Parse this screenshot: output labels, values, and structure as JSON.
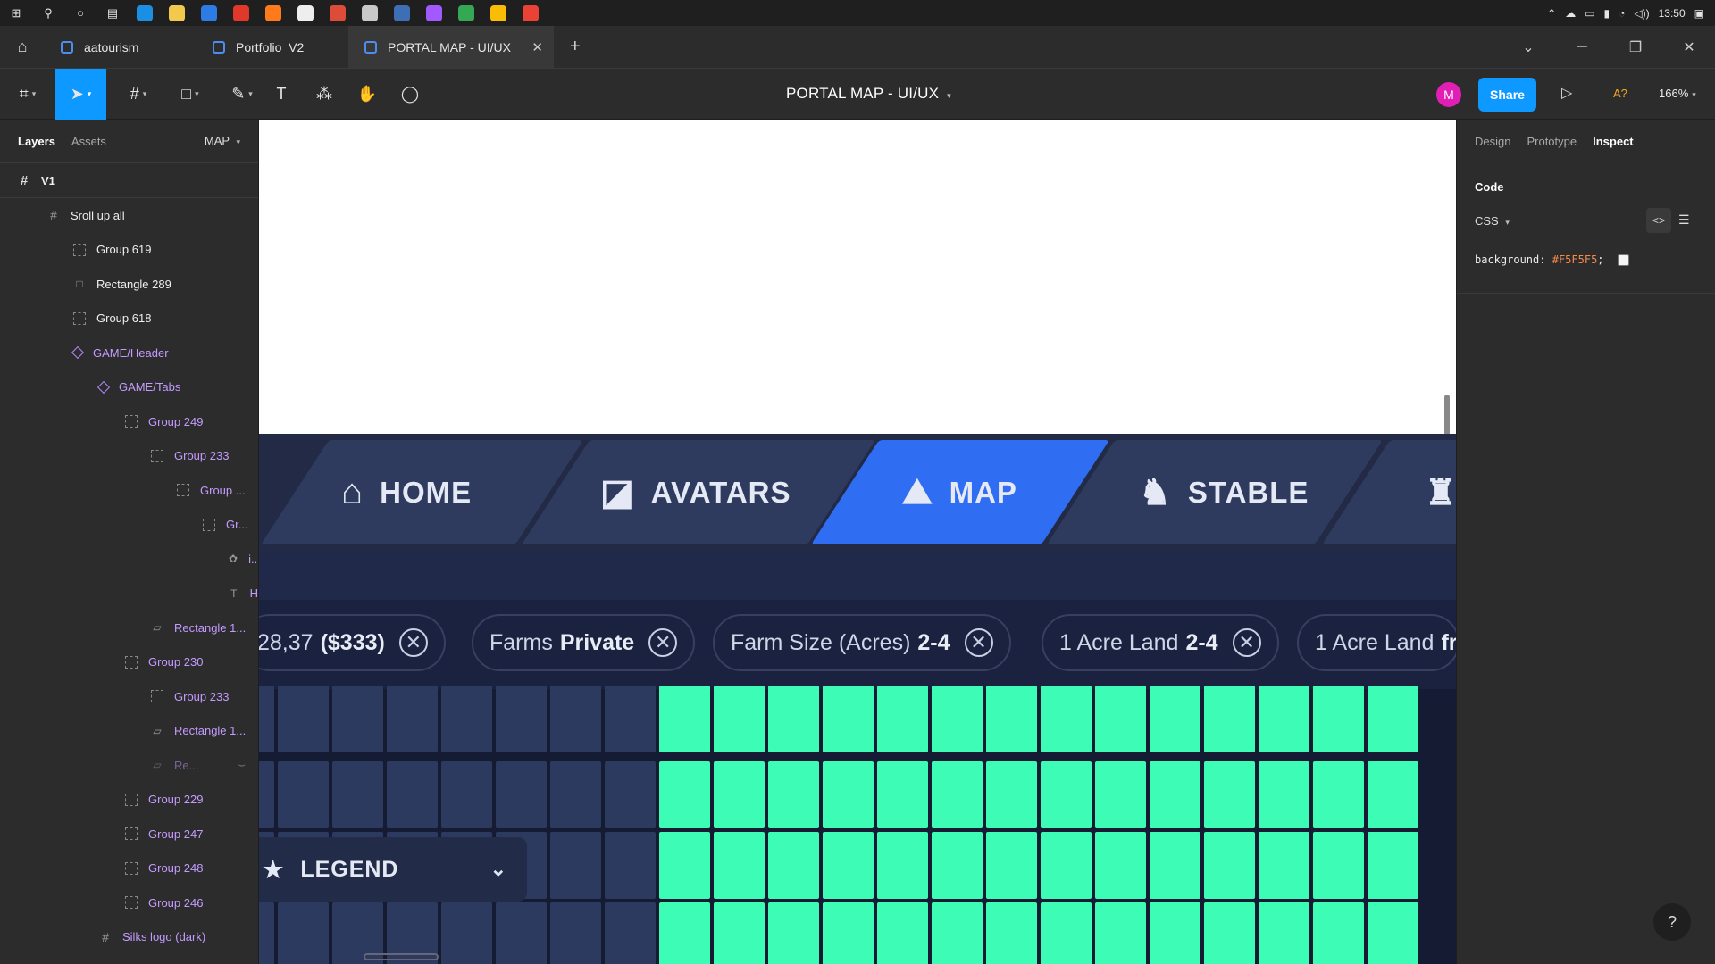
{
  "tray": {
    "time": "13:50"
  },
  "tabs": [
    {
      "label": "aatourism"
    },
    {
      "label": "Portfolio_V2"
    },
    {
      "label": "PORTAL MAP - UI/UX"
    }
  ],
  "toolbar": {
    "doc_title": "PORTAL MAP - UI/UX",
    "avatar_initial": "M",
    "share_label": "Share",
    "aq_label": "A?",
    "zoom": "166%"
  },
  "left_panel": {
    "tab_layers": "Layers",
    "tab_assets": "Assets",
    "page": "MAP",
    "frame": "V1",
    "layers": [
      {
        "label": "Sroll up all",
        "indent": 1,
        "icon": "frame-icon",
        "kind": "frame"
      },
      {
        "label": "Group 619",
        "indent": 2,
        "icon": "group-icon",
        "kind": "group"
      },
      {
        "label": "Rectangle 289",
        "indent": 2,
        "icon": "rectangle-icon",
        "kind": "rect"
      },
      {
        "label": "Group 618",
        "indent": 2,
        "icon": "group-icon",
        "kind": "group"
      },
      {
        "label": "GAME/Header",
        "indent": 2,
        "icon": "component-icon",
        "kind": "comp"
      },
      {
        "label": "GAME/Tabs",
        "indent": 3,
        "icon": "component-icon",
        "kind": "comp"
      },
      {
        "label": "Group 249",
        "indent": 4,
        "icon": "group-icon",
        "kind": "cgroup"
      },
      {
        "label": "Group 233",
        "indent": 5,
        "icon": "group-icon",
        "kind": "cgroup"
      },
      {
        "label": "Group ...",
        "indent": 6,
        "icon": "group-icon",
        "kind": "cgroup"
      },
      {
        "label": "Gr...",
        "indent": 7,
        "icon": "group-icon",
        "kind": "cgroup"
      },
      {
        "label": "i...",
        "indent": 8,
        "icon": "vector-icon",
        "kind": "cgroup"
      },
      {
        "label": "H",
        "indent": 8,
        "icon": "text-icon",
        "kind": "cgroup"
      },
      {
        "label": "Rectangle 1...",
        "indent": 5,
        "icon": "rectangle-icon",
        "kind": "cgroup"
      },
      {
        "label": "Group 230",
        "indent": 4,
        "icon": "group-icon",
        "kind": "cgroup"
      },
      {
        "label": "Group 233",
        "indent": 5,
        "icon": "group-icon",
        "kind": "cgroup"
      },
      {
        "label": "Rectangle 1...",
        "indent": 5,
        "icon": "rectangle-icon",
        "kind": "cgroup"
      },
      {
        "label": "Re...",
        "indent": 5,
        "icon": "rectangle-icon",
        "kind": "hidden"
      },
      {
        "label": "Group 229",
        "indent": 4,
        "icon": "group-icon",
        "kind": "cgroup"
      },
      {
        "label": "Group 247",
        "indent": 4,
        "icon": "group-icon",
        "kind": "cgroup"
      },
      {
        "label": "Group 248",
        "indent": 4,
        "icon": "group-icon",
        "kind": "cgroup"
      },
      {
        "label": "Group 246",
        "indent": 4,
        "icon": "group-icon",
        "kind": "cgroup"
      },
      {
        "label": "Silks logo (dark)",
        "indent": 3,
        "icon": "frame-icon",
        "kind": "comp"
      }
    ]
  },
  "game": {
    "tabs": [
      {
        "label": "HOME",
        "icon": "home-icon"
      },
      {
        "label": "AVATARS",
        "icon": "avatar-icon"
      },
      {
        "label": "MAP",
        "icon": "map-icon",
        "active": true
      },
      {
        "label": "STABLE",
        "icon": "horse-icon"
      }
    ],
    "chips": [
      {
        "text": "28,37",
        "bold": "($333)"
      },
      {
        "text": "Farms",
        "bold": "Private"
      },
      {
        "text": "Farm Size (Acres)",
        "bold": "2-4"
      },
      {
        "text": "1 Acre Land",
        "bold": "2-4"
      },
      {
        "text": "1 Acre Land",
        "bold": "fr"
      }
    ],
    "legend_label": "LEGEND"
  },
  "right_panel": {
    "tab_design": "Design",
    "tab_prototype": "Prototype",
    "tab_inspect": "Inspect",
    "code_heading": "Code",
    "language": "CSS",
    "css_prop": "background:",
    "css_value": "#F5F5F5",
    "css_end": ";",
    "help": "?"
  },
  "colors": {
    "accent": "#0d99ff",
    "game_active_tab": "#2f6df2",
    "map_green": "#3dfcb6",
    "map_dark": "#2d3a5f",
    "swatch": "#F5F5F5"
  }
}
